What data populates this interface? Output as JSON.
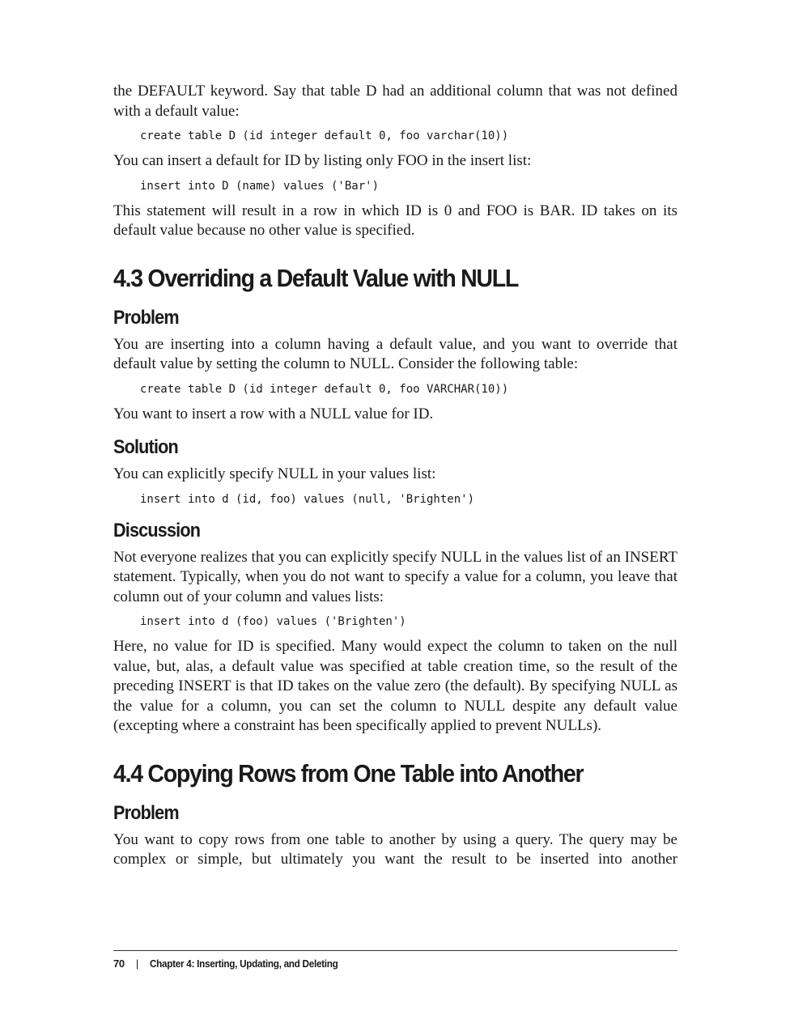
{
  "paragraphs": {
    "p1": "the DEFAULT keyword. Say that table D had an additional column that was not defined with a default value:",
    "code1": "create table D (id integer default 0, foo varchar(10))",
    "p2": "You can insert a default for ID by listing only FOO in the insert list:",
    "code2": "insert into D (name) values ('Bar')",
    "p3": "This statement will result in a row in which ID is 0 and FOO is BAR. ID takes on its default value because no other value is specified."
  },
  "section_4_3": {
    "title": "4.3 Overriding a Default Value with NULL",
    "problem_heading": "Problem",
    "problem_text": "You are inserting into a column having a default value, and you want to override that default value by setting the column to NULL. Consider the following table:",
    "problem_code": "create table D (id integer default 0, foo VARCHAR(10))",
    "problem_text2": "You want to insert a row with a NULL value for ID.",
    "solution_heading": "Solution",
    "solution_text": "You can explicitly specify NULL in your values list:",
    "solution_code": "insert into d (id, foo) values (null, 'Brighten')",
    "discussion_heading": "Discussion",
    "discussion_text1": "Not everyone realizes that you can explicitly specify NULL in the values list of an INSERT statement. Typically, when you do not want to specify a value for a column, you leave that column out of your column and values lists:",
    "discussion_code": "insert into d (foo) values ('Brighten')",
    "discussion_text2": "Here, no value for ID is specified. Many would expect the column to taken on the null value, but, alas, a default value was specified at table creation time, so the result of the preceding INSERT is that ID takes on the value zero (the default). By specifying NULL as the value for a column, you can set the column to NULL despite any default value (excepting where a constraint has been specifically applied to prevent NULLs)."
  },
  "section_4_4": {
    "title": "4.4 Copying Rows from One Table into Another",
    "problem_heading": "Problem",
    "problem_text": "You want to copy rows from one table to another by using a query. The query may be complex or simple, but ultimately you want the result to be inserted into another"
  },
  "footer": {
    "page_number": "70",
    "separator": "|",
    "chapter": "Chapter 4: Inserting, Updating, and Deleting"
  }
}
